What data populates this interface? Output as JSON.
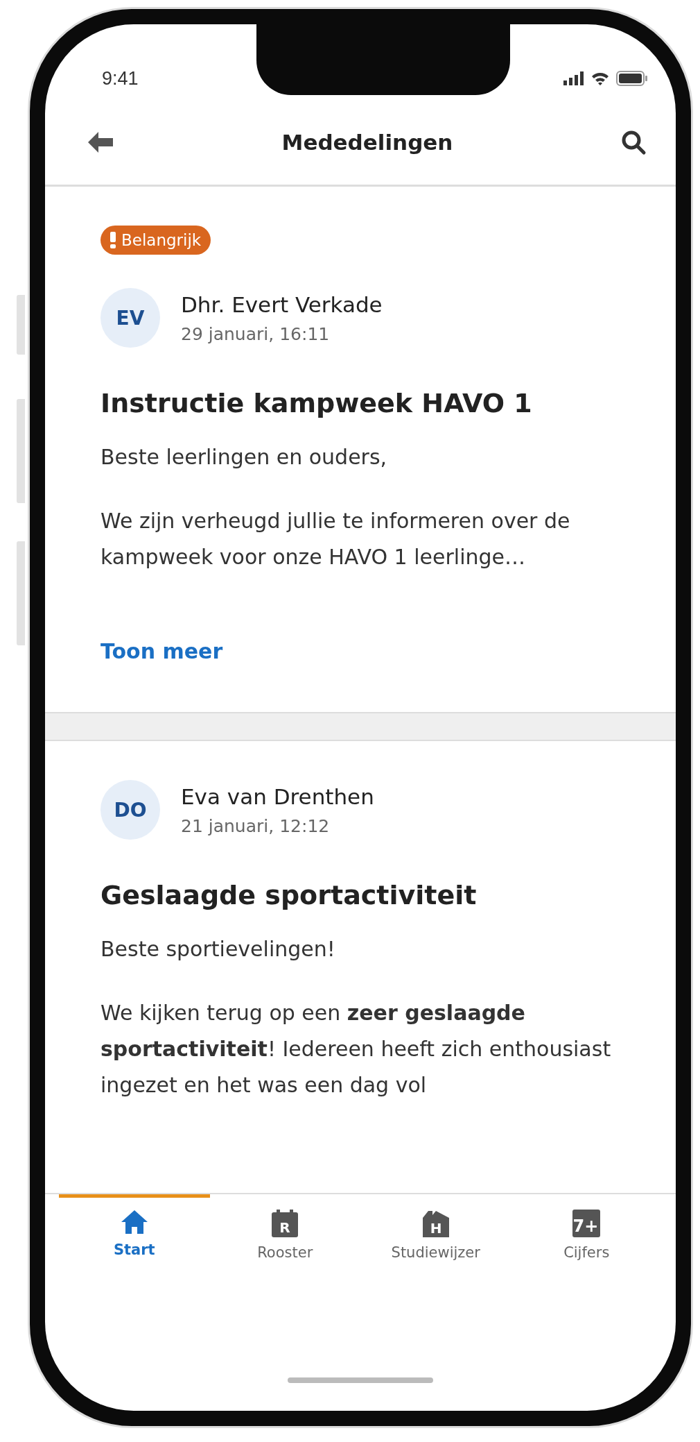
{
  "status_bar": {
    "time": "9:41"
  },
  "header": {
    "title": "Mededelingen"
  },
  "messages": [
    {
      "badge": "Belangrijk",
      "initials": "EV",
      "author": "Dhr. Evert Verkade",
      "date": "29 januari, 16:11",
      "title": "Instructie kampweek HAVO 1",
      "paragraphs": [
        "Beste leerlingen en ouders,",
        "We zijn verheugd jullie te informeren over de kampweek voor onze HAVO 1 leerlinge…"
      ],
      "link": "Toon meer"
    },
    {
      "initials": "DO",
      "author": "Eva van Drenthen",
      "date": "21 januari, 12:12",
      "title": "Geslaagde sportactiviteit",
      "paragraphs": [
        "Beste sportievelingen!",
        "We kijken terug op een **zeer geslaagde sportactiviteit**! Iedereen heeft zich enthousiast ingezet en het was een dag vol"
      ]
    }
  ],
  "tabs": [
    {
      "kind": "home",
      "label": "Start",
      "selected": true
    },
    {
      "kind": "schedule",
      "icon_text": "R",
      "label": "Rooster",
      "selected": false
    },
    {
      "kind": "guide",
      "icon_text": "H",
      "label": "Studiewijzer",
      "selected": false
    },
    {
      "kind": "grades",
      "icon_text": "7+",
      "label": "Cijfers",
      "selected": false
    }
  ]
}
